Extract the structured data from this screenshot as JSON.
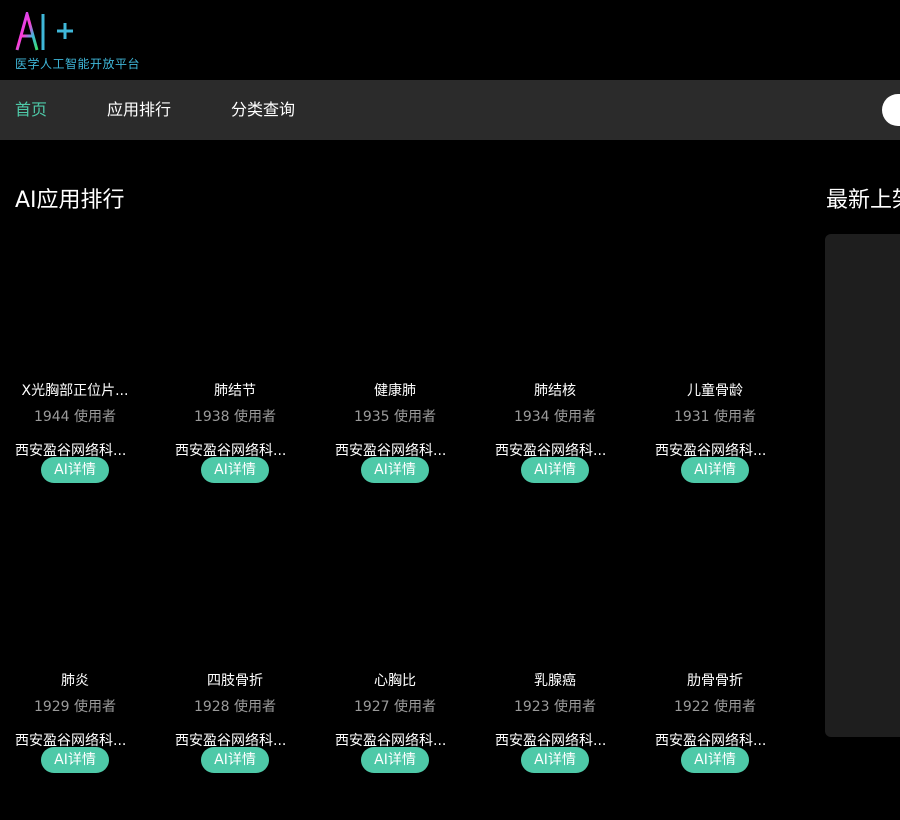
{
  "header": {
    "logo_text": "AI+",
    "logo_subtitle": "医学人工智能开放平台"
  },
  "nav": {
    "items": [
      {
        "label": "首页",
        "active": true
      },
      {
        "label": "应用排行",
        "active": false
      },
      {
        "label": "分类查询",
        "active": false
      }
    ]
  },
  "main": {
    "ranking_title": "AI应用排行",
    "latest_title": "最新上架",
    "apps": [
      {
        "name": "X光胸部正位片...",
        "users": "1944 使用者",
        "company": "西安盈谷网络科...",
        "button": "AI详情"
      },
      {
        "name": "肺结节",
        "users": "1938 使用者",
        "company": "西安盈谷网络科...",
        "button": "AI详情"
      },
      {
        "name": "健康肺",
        "users": "1935 使用者",
        "company": "西安盈谷网络科...",
        "button": "AI详情"
      },
      {
        "name": "肺结核",
        "users": "1934 使用者",
        "company": "西安盈谷网络科...",
        "button": "AI详情"
      },
      {
        "name": "儿童骨龄",
        "users": "1931 使用者",
        "company": "西安盈谷网络科...",
        "button": "AI详情"
      },
      {
        "name": "肺炎",
        "users": "1929 使用者",
        "company": "西安盈谷网络科...",
        "button": "AI详情"
      },
      {
        "name": "四肢骨折",
        "users": "1928 使用者",
        "company": "西安盈谷网络科...",
        "button": "AI详情"
      },
      {
        "name": "心胸比",
        "users": "1927 使用者",
        "company": "西安盈谷网络科...",
        "button": "AI详情"
      },
      {
        "name": "乳腺癌",
        "users": "1923 使用者",
        "company": "西安盈谷网络科...",
        "button": "AI详情"
      },
      {
        "name": "肋骨骨折",
        "users": "1922 使用者",
        "company": "西安盈谷网络科...",
        "button": "AI详情"
      }
    ]
  },
  "colors": {
    "accent": "#4ec9a8",
    "nav_bg": "#2b2b2b",
    "subtitle": "#3fb7d9"
  }
}
